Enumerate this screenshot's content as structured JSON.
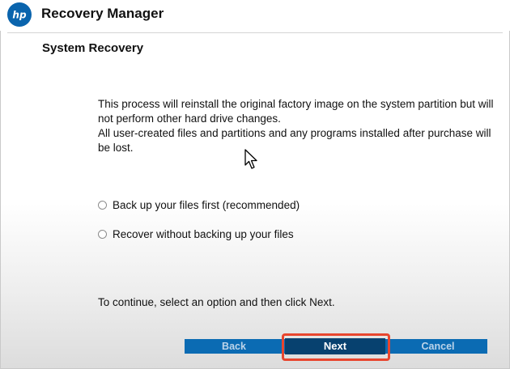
{
  "header": {
    "logo_text": "hp",
    "logo_color": "#0a64ad",
    "app_title": "Recovery Manager"
  },
  "page": {
    "title": "System Recovery",
    "description_line1": "This process will reinstall the original factory image on the system partition but will not perform other hard drive changes.",
    "description_line2": "All user-created files and partitions and any programs installed after purchase will be lost."
  },
  "options": [
    {
      "label": "Back up your files first (recommended)",
      "selected": false
    },
    {
      "label": "Recover without backing up your files",
      "selected": false
    }
  ],
  "instruction": "To continue, select an option and then click Next.",
  "buttons": {
    "back": "Back",
    "next": "Next",
    "cancel": "Cancel"
  },
  "colors": {
    "button_bar": "#0b6bb3",
    "next_button": "#07416f",
    "highlight": "#e8452e"
  }
}
